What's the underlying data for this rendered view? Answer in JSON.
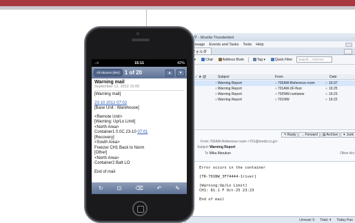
{
  "thunderbird": {
    "window_title": "ルダ - Mozilla Thunderbird",
    "menu": [
      "Message",
      "Events and Tasks",
      "Tools",
      "Help"
    ],
    "tab_label": "フォルダ",
    "toolbar": {
      "prev": "ita ▾",
      "chat": "Chat",
      "address_book": "Address Book",
      "tag": "Tag ▾",
      "quick_filter": "Quick Filter",
      "search_placeholder": "Search... <Ctrl+K>"
    },
    "columns": {
      "thread": "↕",
      "star": "★",
      "attachment": "@",
      "subject": "Subject",
      "from": "From",
      "date": "Date"
    },
    "messages": [
      {
        "subject": "Warning Report",
        "from": "702AW-Reference room",
        "date": "16:37",
        "selected": true
      },
      {
        "subject": "Warning Report",
        "from": "701AW-3F-floor",
        "date": "16:25",
        "selected": false
      },
      {
        "subject": "Warning Report",
        "from": "702NW-container",
        "date": "16:23",
        "selected": false
      },
      {
        "subject": "Warning Report",
        "from": "701NW",
        "date": "16:22",
        "selected": false
      }
    ],
    "header": {
      "buttons": [
        "Reply",
        "Forward",
        "Archive",
        "Junk"
      ],
      "from_label": "From",
      "from_value": "702AW-Reference room <701@tendd.co.jp>",
      "subject_label": "Subject",
      "subject_value": "Warning Report",
      "to_label": "To",
      "to_value": "Mika Marukun",
      "other_actions": "Other Act"
    },
    "body": [
      "Error occurs in the container",
      "",
      "[TR-701NW_3F74444-1river]",
      "",
      "[Warning:Up/Lo Limit]",
      "CH1: 81.1 F  Oct-25 23:23",
      "",
      "End of mail"
    ],
    "status": {
      "unread": "Unread: 0",
      "total": "Total: 4",
      "today": "Today Pan"
    }
  },
  "iphone": {
    "status": {
      "carrier": "..ııl",
      "time": "15:11",
      "battery": "42%"
    },
    "nav": {
      "back": "All Inboxes (894)",
      "count": "1 of 20"
    },
    "mail": {
      "subject": "Warning mail",
      "date": "September 12, 2012   15:00",
      "lines": [
        {
          "text": "[Warning mail]"
        },
        {
          "gap": true
        },
        {
          "text": "23-10 2012 07:02",
          "link": true
        },
        {
          "text": "[Base Unit : Warehouse]"
        },
        {
          "gap": true
        },
        {
          "text": "<Remote Unit>"
        },
        {
          "text": "[Warning: Up/Lo Limit]"
        },
        {
          "text": "<North Area>"
        },
        {
          "text": "Container1 0.0C 23-10 ",
          "tail": "07:01"
        },
        {
          "text": "[Recovery]"
        },
        {
          "text": "<South Area>"
        },
        {
          "text": "Freezer CH1 Back to Norm"
        },
        {
          "text": "[Other]"
        },
        {
          "text": "<North Area>"
        },
        {
          "text": "Container2 Batt LO"
        },
        {
          "gap": true
        },
        {
          "text": "End of mail"
        }
      ]
    },
    "toolbar_icons": [
      "refresh-icon",
      "move-icon",
      "trash-icon",
      "reply-icon",
      "compose-icon"
    ]
  },
  "colors": {
    "brand_band": "#a8383f",
    "ios_nav": "#6d80a3",
    "selection": "#d6e6fb"
  }
}
